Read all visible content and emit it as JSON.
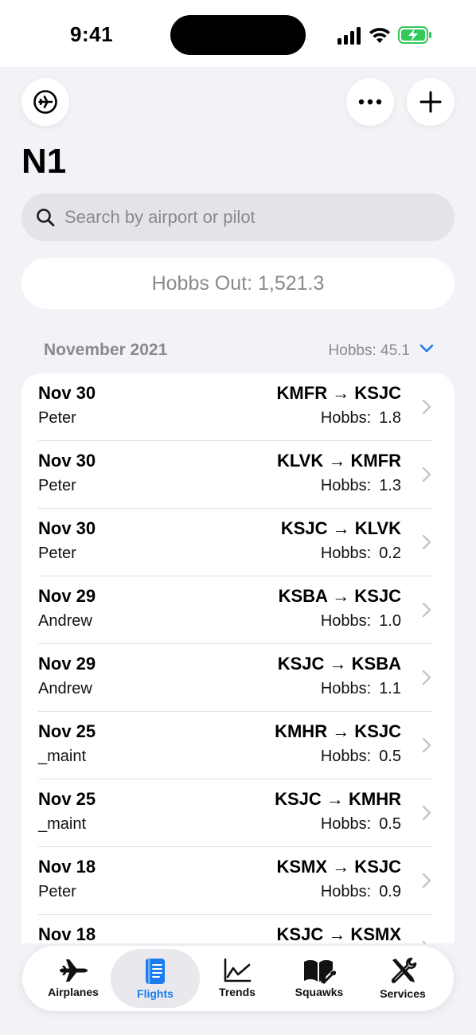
{
  "status_bar": {
    "time": "9:41"
  },
  "header": {
    "title": "N1",
    "left_button_icon": "airplane-circle-icon",
    "more_button_icon": "ellipsis-icon",
    "add_button_icon": "plus-icon"
  },
  "search": {
    "placeholder": "Search by airport or pilot",
    "value": ""
  },
  "hobbs_out": "Hobbs Out: 1,521.3",
  "section": {
    "month": "November 2021",
    "total": "Hobbs: 45.1"
  },
  "flights": [
    {
      "date": "Nov 30",
      "pilot": "Peter",
      "route": "KMFR → KSJC",
      "hobbs_label": "Hobbs:",
      "hobbs_value": "1.8"
    },
    {
      "date": "Nov 30",
      "pilot": "Peter",
      "route": "KLVK → KMFR",
      "hobbs_label": "Hobbs:",
      "hobbs_value": "1.3"
    },
    {
      "date": "Nov 30",
      "pilot": "Peter",
      "route": "KSJC → KLVK",
      "hobbs_label": "Hobbs:",
      "hobbs_value": "0.2"
    },
    {
      "date": "Nov 29",
      "pilot": "Andrew",
      "route": "KSBA → KSJC",
      "hobbs_label": "Hobbs:",
      "hobbs_value": "1.0"
    },
    {
      "date": "Nov 29",
      "pilot": "Andrew",
      "route": "KSJC → KSBA",
      "hobbs_label": "Hobbs:",
      "hobbs_value": "1.1"
    },
    {
      "date": "Nov 25",
      "pilot": "_maint",
      "route": "KMHR → KSJC",
      "hobbs_label": "Hobbs:",
      "hobbs_value": "0.5"
    },
    {
      "date": "Nov 25",
      "pilot": "_maint",
      "route": "KSJC → KMHR",
      "hobbs_label": "Hobbs:",
      "hobbs_value": "0.5"
    },
    {
      "date": "Nov 18",
      "pilot": "Peter",
      "route": "KSMX → KSJC",
      "hobbs_label": "Hobbs:",
      "hobbs_value": "0.9"
    },
    {
      "date": "Nov 18",
      "pilot": "",
      "route": "KSJC → KSMX",
      "hobbs_label": "",
      "hobbs_value": ""
    }
  ],
  "tabs": [
    {
      "label": "Airplanes",
      "icon": "airplane-icon",
      "active": false
    },
    {
      "label": "Flights",
      "icon": "logbook-icon",
      "active": true
    },
    {
      "label": "Trends",
      "icon": "chart-line-icon",
      "active": false
    },
    {
      "label": "Squawks",
      "icon": "book-wrench-icon",
      "active": false
    },
    {
      "label": "Services",
      "icon": "tools-icon",
      "active": false
    }
  ],
  "colors": {
    "accent": "#1a7cf0",
    "secondary_text": "#8a8a8e",
    "background": "#f2f2f7",
    "battery": "#34c759"
  }
}
